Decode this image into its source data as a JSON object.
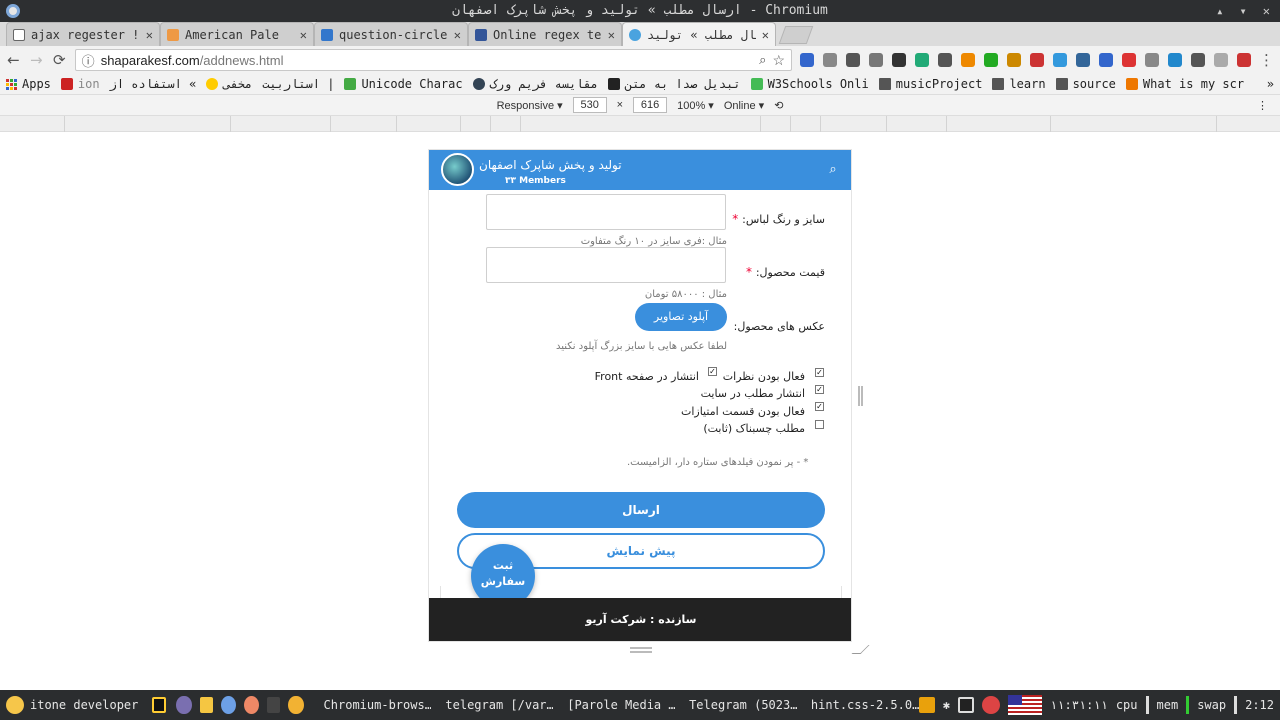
{
  "window": {
    "title": "ارسال مطلب » تولید و پخش شاپرک اصفهان - Chromium",
    "controls": [
      "▴",
      "▾",
      "✕"
    ]
  },
  "tabs": [
    {
      "label": "ajax regester !!!",
      "color": "#666"
    },
    {
      "label": "American Pale",
      "color": "#e94"
    },
    {
      "label": "question-circle",
      "color": "#37c"
    },
    {
      "label": "Online regex test",
      "color": "#359"
    },
    {
      "label": "ارسال مطلب » تولید",
      "color": "#4aa3df",
      "active": true
    }
  ],
  "toolbar": {
    "url_host": "shaparakesf.com",
    "url_path": "/addnews.html",
    "back": "←",
    "forward": "→",
    "reload": "⟳",
    "info": "ⓘ",
    "zoom": "⌕",
    "star": "☆",
    "menu": "⋮",
    "extension_colors": [
      "#36c",
      "#888",
      "#555",
      "#777",
      "#333",
      "#2a7",
      "#555",
      "#e80",
      "#2a2",
      "#c80",
      "#c33",
      "#39d",
      "#369",
      "#36c",
      "#d33",
      "#888",
      "#28c",
      "#555",
      "#aaa",
      "#c33"
    ]
  },
  "bookmarks": [
    {
      "label": "Apps",
      "kind": "apps"
    },
    {
      "label": "ion",
      "color": "#c22"
    },
    {
      "label": "استفاده از «",
      "color": ""
    },
    {
      "label": "مخفی",
      "color": "#fc0"
    },
    {
      "label": "استاربیت |",
      "color": ""
    },
    {
      "label": "Unicode Charac",
      "color": "#4a4"
    },
    {
      "label": "مقایسه فریم ورک",
      "color": "#345"
    },
    {
      "label": "تبدیل صدا به متن",
      "color": "#222"
    },
    {
      "label": "W3Schools Onli",
      "color": "#4b5"
    },
    {
      "label": "musicProject",
      "kind": "folder"
    },
    {
      "label": "learn",
      "kind": "folder"
    },
    {
      "label": "source",
      "kind": "folder"
    },
    {
      "label": "What is my scr",
      "color": "#e70"
    }
  ],
  "devtools": {
    "device": "Responsive ▾",
    "width": "530",
    "times": "×",
    "height": "616",
    "zoom": "100% ▾",
    "network": "Online ▾",
    "rotate": "⟲"
  },
  "app": {
    "title": "تولید و پخش شاپرک اصفهان",
    "members": "۳۳ Members",
    "search_icon": "⌕",
    "cutoff_text": "— — — —",
    "fields": {
      "size_label": "سایز و رنگ لباس:",
      "size_hint": "مثال :فری سایز در ۱۰ رنگ متفاوت",
      "price_label": "قیمت محصول:",
      "price_hint": "مثال : ۵۸۰۰۰ تومان",
      "photos_label": "عکس های محصول:",
      "upload_button": "آپلود تصاویر",
      "photos_hint": "لطفا عکس هایی با سایز بزرگ آپلود نکنید",
      "required_mark": "*"
    },
    "checkboxes": [
      {
        "label": "فعال بودن نظرات",
        "checked": true
      },
      {
        "label": "انتشار در صفحه Front",
        "checked": true
      },
      {
        "label": "انتشار مطلب در سایت",
        "checked": true
      },
      {
        "label": "فعال بودن قسمت امتیازات",
        "checked": true
      },
      {
        "label": "مطلب چسبناک (ثابت)",
        "checked": false
      }
    ],
    "required_note": "* - پر نمودن فیلدهای ستاره دار، الزامیست.",
    "submit_button": "ارسال",
    "preview_button": "پیش نمایش",
    "fab_line1": "ثبت",
    "fab_line2": "سفارش",
    "footer": "سازنده : شرکت آریو",
    "accent": "#3a8fdd"
  },
  "taskbar": {
    "start_label": "itone developer",
    "windows": [
      {
        "label": "Chromium-brows…",
        "color": "#4a8fe0"
      },
      {
        "label": "telegram [/var…",
        "color": "#333"
      },
      {
        "label": "[Parole Media …",
        "color": "#a44"
      },
      {
        "label": "Telegram (5023…",
        "color": "#39c"
      },
      {
        "label": "hint.css-2.5.0…",
        "color": "#e90"
      }
    ],
    "clock": "۱۱:۳۱:۱۱",
    "stats": [
      "cpu",
      "mem",
      "swap"
    ],
    "time_right": "2:12"
  }
}
